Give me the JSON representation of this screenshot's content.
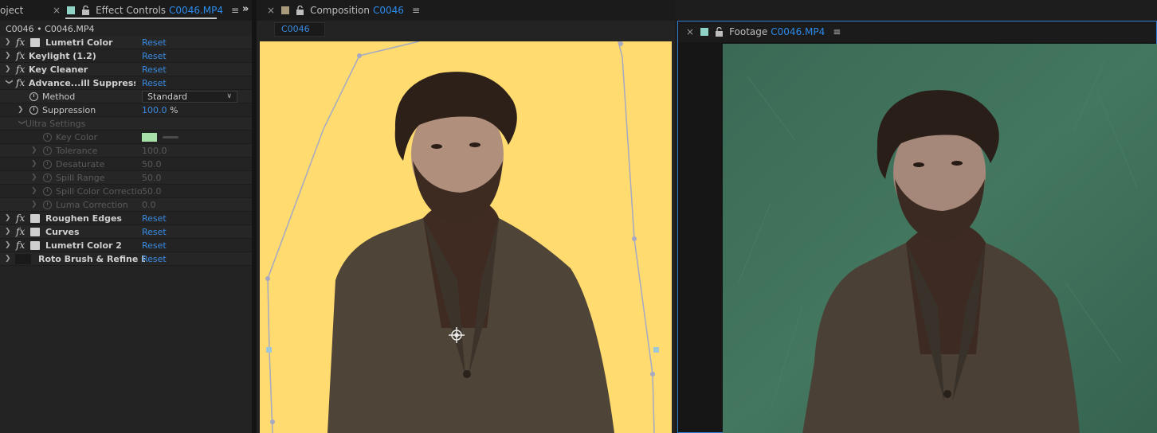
{
  "left_panel": {
    "tabs": [
      {
        "label": "oject"
      },
      {
        "close": "×",
        "label": "Effect Controls",
        "file": "C0046.MP4",
        "menu": "≡"
      }
    ],
    "overflow_icon": "»",
    "subtitle": "C0046 • C0046.MP4",
    "effects": [
      {
        "name": "Lumetri Color",
        "reset": "Reset"
      },
      {
        "name": "Keylight (1.2)",
        "reset": "Reset"
      },
      {
        "name": "Key Cleaner",
        "reset": "Reset"
      },
      {
        "name": "Advance...ill Suppressor",
        "reset": "Reset"
      }
    ],
    "method": {
      "label": "Method",
      "value": "Standard"
    },
    "suppression": {
      "label": "Suppression",
      "value": "100.0",
      "unit": "%"
    },
    "ultra": {
      "label": "Ultra Settings",
      "key_color": {
        "label": "Key Color",
        "color": "#a6dfa7"
      },
      "props": [
        {
          "label": "Tolerance",
          "value": "100.0"
        },
        {
          "label": "Desaturate",
          "value": "50.0"
        },
        {
          "label": "Spill Range",
          "value": "50.0"
        },
        {
          "label": "Spill Color Correctio",
          "value": "50.0"
        },
        {
          "label": "Luma Correction",
          "value": "0.0"
        }
      ]
    },
    "effects_after": [
      {
        "name": "Roughen Edges",
        "reset": "Reset"
      },
      {
        "name": "Curves",
        "reset": "Reset"
      },
      {
        "name": "Lumetri Color 2",
        "reset": "Reset"
      },
      {
        "name": "Roto Brush & Refine Edge",
        "reset": "Reset"
      }
    ]
  },
  "composition": {
    "close": "×",
    "label": "Composition",
    "name": "C0046",
    "menu": "≡",
    "sub_tab": "C0046",
    "background_color": "#ffdb70"
  },
  "footage": {
    "close": "×",
    "label": "Footage",
    "file": "C0046.MP4",
    "menu": "≡"
  },
  "colors": {
    "accent": "#2d8ceb",
    "reset_blue": "#3a8be3",
    "label_teal": "#8fd3c6",
    "label_tan": "#a89a7a",
    "panel_focus": "#2d7fd6"
  }
}
